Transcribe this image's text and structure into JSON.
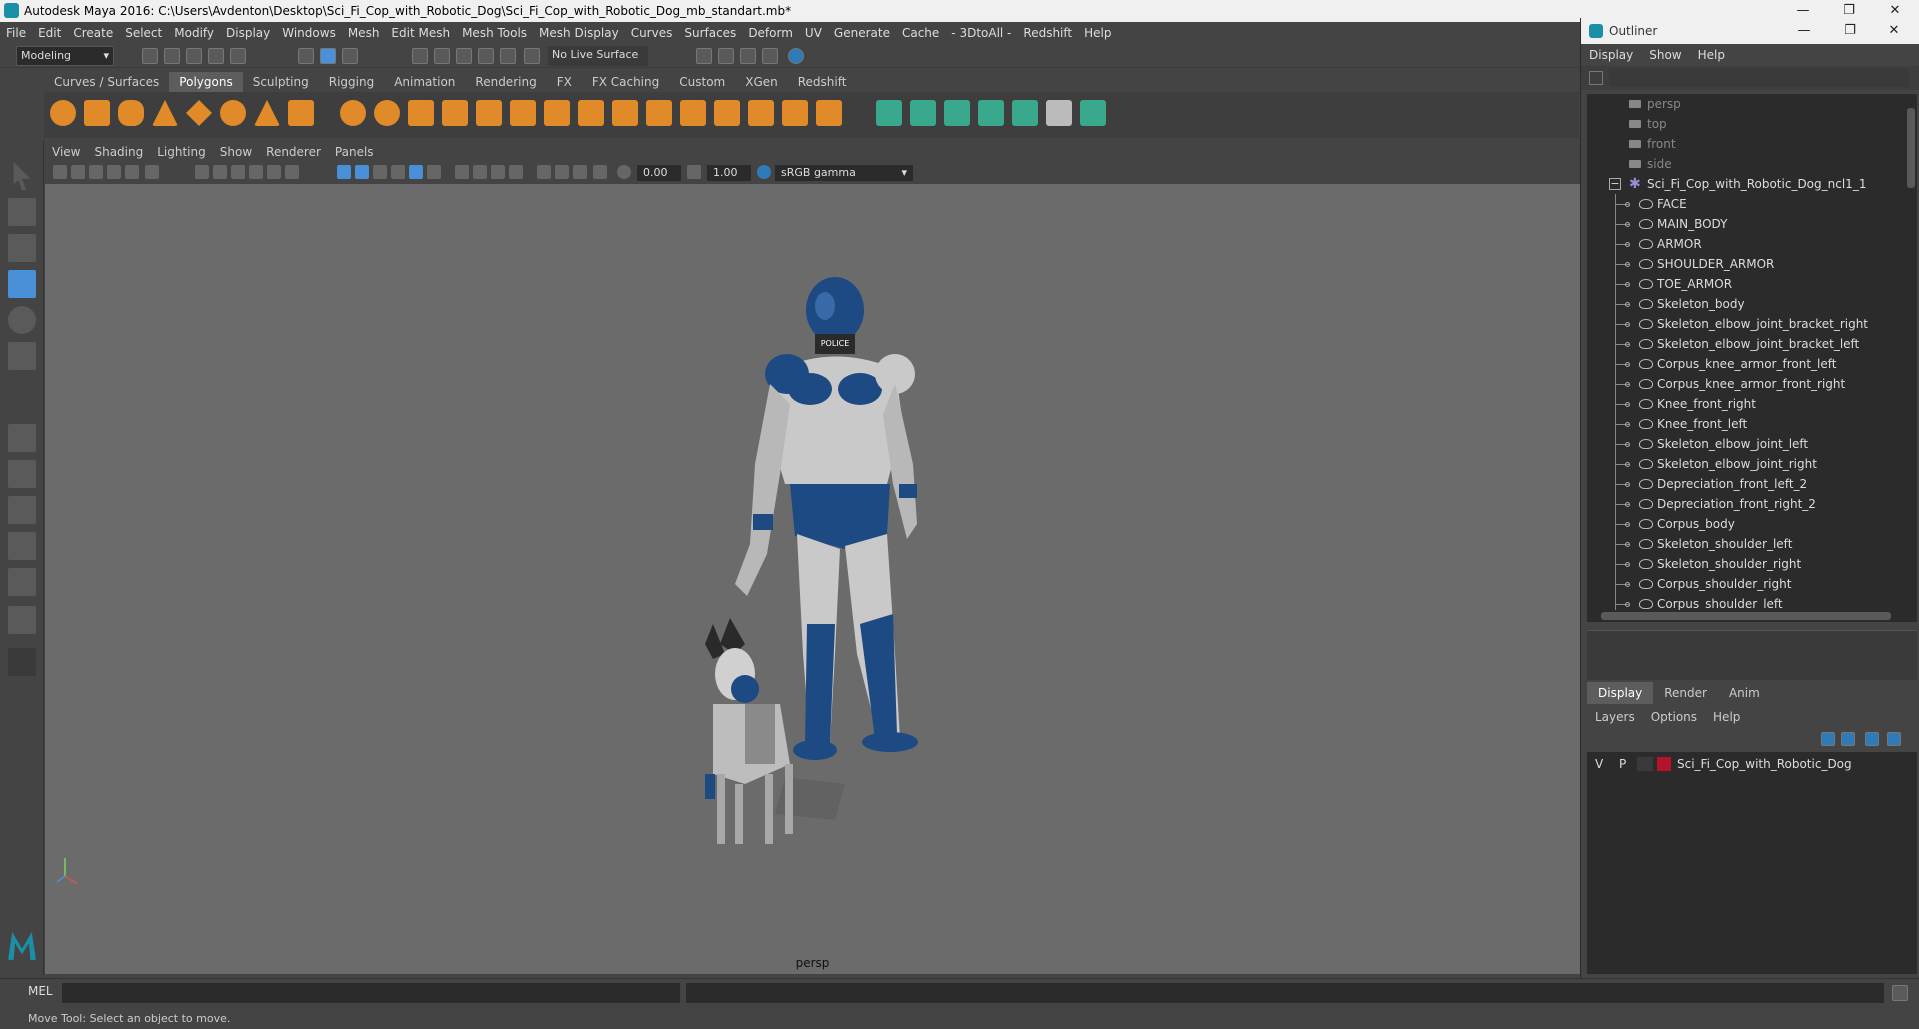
{
  "window": {
    "title": "Autodesk Maya 2016: C:\\Users\\Avdenton\\Desktop\\Sci_Fi_Cop_with_Robotic_Dog\\Sci_Fi_Cop_with_Robotic_Dog_mb_standart.mb*",
    "minimize": "—",
    "maximize": "❐",
    "close": "✕"
  },
  "menubar": [
    "File",
    "Edit",
    "Create",
    "Select",
    "Modify",
    "Display",
    "Windows",
    "Mesh",
    "Edit Mesh",
    "Mesh Tools",
    "Mesh Display",
    "Curves",
    "Surfaces",
    "Deform",
    "UV",
    "Generate",
    "Cache",
    "- 3DtoAll -",
    "Redshift",
    "Help"
  ],
  "toolrow": {
    "mode": "Modeling",
    "live_surface": "No Live Surface"
  },
  "shelf_tabs": [
    "Curves / Surfaces",
    "Polygons",
    "Sculpting",
    "Rigging",
    "Animation",
    "Rendering",
    "FX",
    "FX Caching",
    "Custom",
    "XGen",
    "Redshift"
  ],
  "shelf_active": "Polygons",
  "viewport_menu": [
    "View",
    "Shading",
    "Lighting",
    "Show",
    "Renderer",
    "Panels"
  ],
  "viewport_toolbar": {
    "exposure": "0.00",
    "gamma": "1.00",
    "color_space": "sRGB gamma"
  },
  "viewport": {
    "camera_label": "persp"
  },
  "commandline": {
    "lang": "MEL",
    "status": "Move Tool: Select an object to move."
  },
  "outliner": {
    "title": "Outliner",
    "menu": [
      "Display",
      "Show",
      "Help"
    ],
    "cameras": [
      "persp",
      "top",
      "front",
      "side"
    ],
    "root": "Sci_Fi_Cop_with_Robotic_Dog_ncl1_1",
    "children": [
      "FACE",
      "MAIN_BODY",
      "ARMOR",
      "SHOULDER_ARMOR",
      "TOE_ARMOR",
      "Skeleton_body",
      "Skeleton_elbow_joint_bracket_right",
      "Skeleton_elbow_joint_bracket_left",
      "Corpus_knee_armor_front_left",
      "Corpus_knee_armor_front_right",
      "Knee_front_right",
      "Knee_front_left",
      "Skeleton_elbow_joint_left",
      "Skeleton_elbow_joint_right",
      "Depreciation_front_left_2",
      "Depreciation_front_right_2",
      "Corpus_body",
      "Skeleton_shoulder_left",
      "Skeleton_shoulder_right",
      "Corpus_shoulder_right",
      "Corpus_shoulder_left"
    ]
  },
  "layers": {
    "tabs": [
      "Display",
      "Render",
      "Anim"
    ],
    "active_tab": "Display",
    "menu": [
      "Layers",
      "Options",
      "Help"
    ],
    "rows": [
      {
        "v": "V",
        "p": "P",
        "name": "Sci_Fi_Cop_with_Robotic_Dog",
        "color": "#b3142c"
      }
    ]
  },
  "colors": {
    "accent": "#4a90d9",
    "armor_blue": "#1d4a82",
    "armor_white": "#c9c9c9"
  }
}
